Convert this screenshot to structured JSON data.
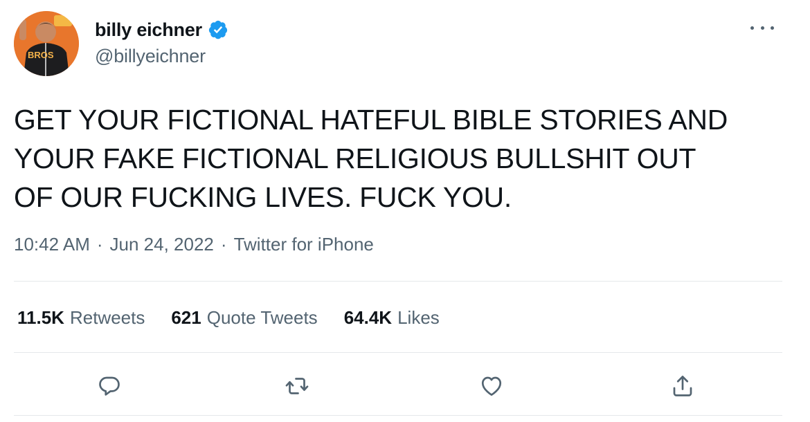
{
  "author": {
    "display_name": "billy eichner",
    "handle": "@billyeichner",
    "verified": true,
    "avatar_text": "BROS"
  },
  "tweet": {
    "text_lines": [
      "GET YOUR FICTIONAL HATEFUL BIBLE STORIES AND",
      "YOUR FAKE FICTIONAL RELIGIOUS BULLSHIT OUT",
      "OF OUR FUCKING LIVES. FUCK YOU."
    ],
    "time": "10:42 AM",
    "date": "Jun 24, 2022",
    "source": "Twitter for iPhone",
    "separator": "·"
  },
  "stats": {
    "retweets": {
      "count": "11.5K",
      "label": "Retweets"
    },
    "quotes": {
      "count": "621",
      "label": "Quote Tweets"
    },
    "likes": {
      "count": "64.4K",
      "label": "Likes"
    }
  },
  "actions": {
    "reply_icon": "reply-icon",
    "retweet_icon": "retweet-icon",
    "like_icon": "heart-icon",
    "share_icon": "share-icon"
  },
  "colors": {
    "text_primary": "#0f1419",
    "text_secondary": "#536471",
    "verified_blue": "#1d9bf0",
    "divider": "#e5e8eb"
  }
}
